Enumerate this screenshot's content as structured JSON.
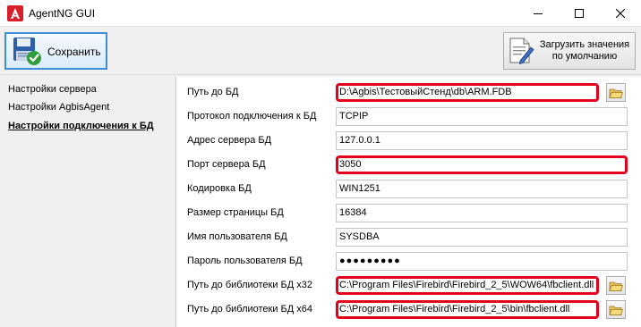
{
  "window": {
    "title": "AgentNG GUI",
    "icon": "app-logo-icon"
  },
  "toolbar": {
    "save_label": "Сохранить",
    "defaults_label_line1": "Загрузить значения",
    "defaults_label_line2": "по умолчанию"
  },
  "nav": {
    "items": [
      {
        "label": "Настройки сервера",
        "active": false
      },
      {
        "label": "Настройки AgbisAgent",
        "active": false
      },
      {
        "label": "Настройки подключения к БД",
        "active": true
      }
    ]
  },
  "form": {
    "rows": [
      {
        "label": "Путь до БД",
        "value": "D:\\Agbis\\ТестовыйСтенд\\db\\ARM.FDB",
        "highlighted": true,
        "browse": true
      },
      {
        "label": "Протокол подключения к БД",
        "value": "TCPIP",
        "highlighted": false,
        "browse": false
      },
      {
        "label": "Адрес сервера БД",
        "value": "127.0.0.1",
        "highlighted": false,
        "browse": false
      },
      {
        "label": "Порт сервера БД",
        "value": "3050",
        "highlighted": true,
        "browse": false
      },
      {
        "label": "Кодировка БД",
        "value": "WIN1251",
        "highlighted": false,
        "browse": false
      },
      {
        "label": "Размер страницы БД",
        "value": "16384",
        "highlighted": false,
        "browse": false
      },
      {
        "label": "Имя пользователя БД",
        "value": "SYSDBA",
        "highlighted": false,
        "browse": false
      },
      {
        "label": "Пароль пользователя БД",
        "value": "●●●●●●●●●",
        "highlighted": false,
        "browse": false
      },
      {
        "label": "Путь до библиотеки БД x32",
        "value": "C:\\Program Files\\Firebird\\Firebird_2_5\\WOW64\\fbclient.dll",
        "highlighted": true,
        "browse": true
      },
      {
        "label": "Путь до библиотеки БД x64",
        "value": "C:\\Program Files\\Firebird\\Firebird_2_5\\bin\\fbclient.dll",
        "highlighted": true,
        "browse": true
      }
    ]
  },
  "colors": {
    "highlight": "#e2001a",
    "save_border": "#3c8fd6"
  }
}
